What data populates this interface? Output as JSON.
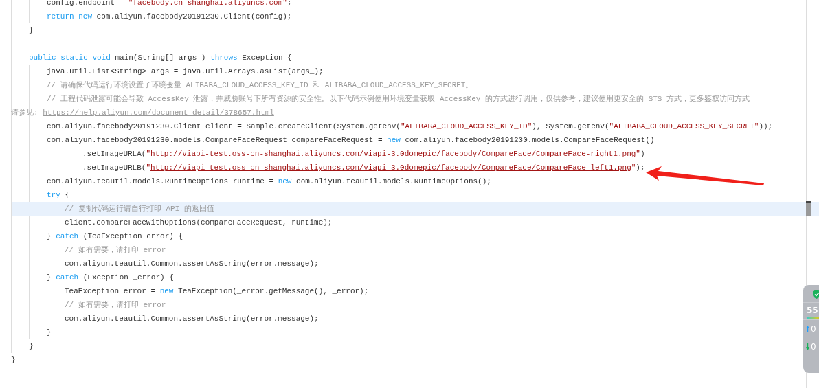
{
  "code": [
    {
      "children": [
        {
          "children": [
            {
              "tokens": [
                {
                  "kind": "plain",
                  "text": "config.endpoint = "
                },
                {
                  "kind": "string",
                  "text": "\"facebody.cn-shanghai.aliyuncs.com\""
                },
                {
                  "kind": "plain",
                  "text": ";"
                }
              ]
            },
            {
              "tokens": [
                {
                  "kind": "keyword",
                  "text": "return new"
                },
                {
                  "kind": "plain",
                  "text": " com.aliyun.facebody20191230.Client(config);"
                }
              ]
            }
          ]
        },
        {
          "tokens": [
            {
              "kind": "plain",
              "text": "}"
            }
          ]
        },
        {
          "kind": "blank"
        },
        {
          "tokens": [
            {
              "kind": "keyword",
              "text": "public static void"
            },
            {
              "kind": "plain",
              "text": " main(String[] args_) "
            },
            {
              "kind": "keyword",
              "text": "throws"
            },
            {
              "kind": "plain",
              "text": " Exception {"
            }
          ],
          "children": [
            {
              "tokens": [
                {
                  "kind": "plain",
                  "text": "java.util.List<String> args = java.util.Arrays.asList(args_);"
                }
              ]
            },
            {
              "tokens": [
                {
                  "kind": "comment",
                  "text": "// 请确保代码运行环境设置了环境变量 ALIBABA_CLOUD_ACCESS_KEY_ID 和 ALIBABA_CLOUD_ACCESS_KEY_SECRET。"
                }
              ]
            },
            {
              "tokens": [
                {
                  "kind": "comment",
                  "text": "// 工程代码泄露可能会导致 AccessKey 泄露，并威胁账号下所有资源的安全性。以下代码示例使用环境变量获取 AccessKey 的方式进行调用，仅供参考，建议使用更安全的 STS 方式，更多鉴权访问方式"
                }
              ],
              "continuation": [
                {
                  "kind": "comment",
                  "text": "请参见: "
                },
                {
                  "kind": "link",
                  "text": "https://help.aliyun.com/document_detail/378657.html"
                }
              ]
            },
            {
              "tokens": [
                {
                  "kind": "plain",
                  "text": "com.aliyun.facebody20191230.Client client = Sample.createClient(System.getenv("
                },
                {
                  "kind": "string",
                  "text": "\"ALIBABA_CLOUD_ACCESS_KEY_ID\""
                },
                {
                  "kind": "plain",
                  "text": "), System.getenv("
                },
                {
                  "kind": "string",
                  "text": "\"ALIBABA_CLOUD_ACCESS_KEY_SECRET\""
                },
                {
                  "kind": "plain",
                  "text": "));"
                }
              ]
            },
            {
              "tokens": [
                {
                  "kind": "plain",
                  "text": "com.aliyun.facebody20191230.models.CompareFaceRequest compareFaceRequest = "
                },
                {
                  "kind": "keyword",
                  "text": "new"
                },
                {
                  "kind": "plain",
                  "text": " com.aliyun.facebody20191230.models.CompareFaceRequest()"
                }
              ],
              "children": [
                {
                  "children": [
                    {
                      "tokens": [
                        {
                          "kind": "plain",
                          "text": ".setImageURLA("
                        },
                        {
                          "kind": "string",
                          "text": "\""
                        },
                        {
                          "kind": "url",
                          "text": "http://viapi-test.oss-cn-shanghai.aliyuncs.com/viapi-3.0domepic/facebody/CompareFace/CompareFace-right1.png"
                        },
                        {
                          "kind": "string",
                          "text": "\""
                        },
                        {
                          "kind": "plain",
                          "text": ")"
                        }
                      ]
                    },
                    {
                      "tokens": [
                        {
                          "kind": "plain",
                          "text": ".setImageURLB("
                        },
                        {
                          "kind": "string",
                          "text": "\""
                        },
                        {
                          "kind": "url",
                          "text": "http://viapi-test.oss-cn-shanghai.aliyuncs.com/viapi-3.0domepic/facebody/CompareFace/CompareFace-left1.png"
                        },
                        {
                          "kind": "string",
                          "text": "\""
                        },
                        {
                          "kind": "plain",
                          "text": ");"
                        }
                      ]
                    }
                  ]
                }
              ]
            },
            {
              "tokens": [
                {
                  "kind": "plain",
                  "text": "com.aliyun.teautil.models.RuntimeOptions runtime = "
                },
                {
                  "kind": "keyword",
                  "text": "new"
                },
                {
                  "kind": "plain",
                  "text": " com.aliyun.teautil.models.RuntimeOptions();"
                }
              ]
            },
            {
              "tokens": [
                {
                  "kind": "keyword",
                  "text": "try"
                },
                {
                  "kind": "plain",
                  "text": " {"
                }
              ],
              "children": [
                {
                  "highlighted": true,
                  "tokens": [
                    {
                      "kind": "comment",
                      "text": "// 复制代码运行请自行打印 API 的返回值"
                    }
                  ]
                },
                {
                  "tokens": [
                    {
                      "kind": "plain",
                      "text": "client.compareFaceWithOptions(compareFaceRequest, runtime);"
                    }
                  ]
                }
              ]
            },
            {
              "tokens": [
                {
                  "kind": "plain",
                  "text": "} "
                },
                {
                  "kind": "keyword",
                  "text": "catch"
                },
                {
                  "kind": "plain",
                  "text": " (TeaException error) {"
                }
              ],
              "children": [
                {
                  "tokens": [
                    {
                      "kind": "comment",
                      "text": "// 如有需要，请打印 error"
                    }
                  ]
                },
                {
                  "tokens": [
                    {
                      "kind": "plain",
                      "text": "com.aliyun.teautil.Common.assertAsString(error.message);"
                    }
                  ]
                }
              ]
            },
            {
              "tokens": [
                {
                  "kind": "plain",
                  "text": "} "
                },
                {
                  "kind": "keyword",
                  "text": "catch"
                },
                {
                  "kind": "plain",
                  "text": " (Exception _error) {"
                }
              ],
              "children": [
                {
                  "tokens": [
                    {
                      "kind": "plain",
                      "text": "TeaException error = "
                    },
                    {
                      "kind": "keyword",
                      "text": "new"
                    },
                    {
                      "kind": "plain",
                      "text": " TeaException(_error.getMessage(), _error);"
                    }
                  ]
                },
                {
                  "tokens": [
                    {
                      "kind": "comment",
                      "text": "// 如有需要，请打印 error"
                    }
                  ]
                },
                {
                  "tokens": [
                    {
                      "kind": "plain",
                      "text": "com.aliyun.teautil.Common.assertAsString(error.message);"
                    }
                  ]
                }
              ]
            },
            {
              "tokens": [
                {
                  "kind": "plain",
                  "text": "}"
                }
              ]
            }
          ]
        },
        {
          "tokens": [
            {
              "kind": "plain",
              "text": "}"
            }
          ]
        }
      ]
    },
    {
      "tokens": [
        {
          "kind": "plain",
          "text": "}"
        }
      ]
    }
  ],
  "net_widget": {
    "score": "55",
    "upload": "0",
    "download": "0"
  }
}
